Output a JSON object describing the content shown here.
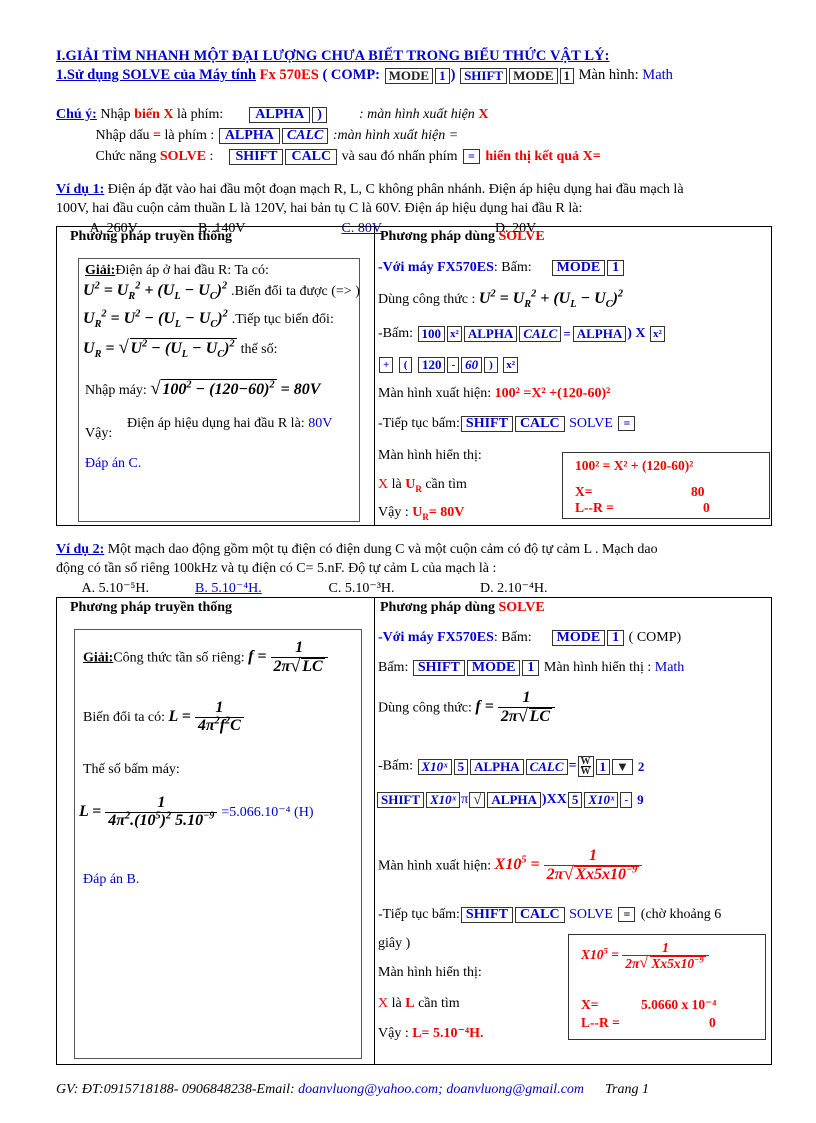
{
  "header": {
    "title": "I.GIẢI TÌM NHANH MỘT ĐẠI LƯỢNG CHƯA BIẾT TRONG BIỂU THỨC VẬT LÝ:",
    "line2_a": "1.Sử dụng  SOLVE  của Máy tính",
    "line2_calc": "Fx 570ES",
    "line2_b": "( COMP:",
    "key_mode": "MODE",
    "key_1": "1",
    "line2_c": ")",
    "key_shift": "SHIFT",
    "key_mode2": "MODE",
    "key_1b": "1",
    "line2_d": "Màn hình:",
    "line2_math": "Math"
  },
  "note": {
    "label": "Chú ý:",
    "r1_a": "Nhập",
    "r1_var": "biến X",
    "r1_b": "là phím:",
    "r1_key1": "ALPHA",
    "r1_key2": ")",
    "r1_c": ": màn hình xuất hiện",
    "r1_x": "X",
    "r2_a": "Nhập dấu",
    "r2_eq": "=",
    "r2_b": "là  phím :",
    "r2_key1": "ALPHA",
    "r2_key2": "CALC",
    "r2_c": ":màn hình xuất hiện =",
    "r3_a": "Chức năng",
    "r3_solve": "SOLVE",
    "r3_colon": ":",
    "r3_key1": "SHIFT",
    "r3_key2": "CALC",
    "r3_b": "và sau đó nhấn  phím",
    "r3_key3": "=",
    "r3_c": "hiển thị kết  quả X="
  },
  "example1": {
    "label": "Ví dụ 1:",
    "prompt_l1": "Điện áp đặt vào hai đầu một đoạn mạch R, L, C không phân nhánh. Điện áp hiệu dụng hai đầu mạch là",
    "prompt_l2": "100V, hai đầu cuộn cảm thuần L là 120V, hai bản tụ C là 60V. Điện áp hiệu  dụng hai đầu R là:",
    "options": [
      "A. 260V",
      "B. 140V",
      "C. 80V",
      "D. 20V"
    ],
    "answer_key": "C",
    "left_caption": "Phương pháp truyền thống",
    "right_caption_a": "Phương pháp dùng",
    "right_caption_b": "SOLVE",
    "left": {
      "giai": "Giải:",
      "l1": "Điện áp ở hai đầu R: Ta có:",
      "eq1_tail": ".Biến  đổi ta được (=> )",
      "eq2_tail": ".Tiếp tục biến  đổi:",
      "eq3_tail": "thế số:",
      "l2": "Nhập máy:",
      "numeric_result": "80V",
      "vay": "Vậy:",
      "concl_a": "Điện áp hiệu  dụng hai đầu R là:",
      "concl_b": "80V",
      "dapan": "Đáp án C."
    },
    "right": {
      "r1_a": "-Với máy FX570ES",
      "r1_b": ": Bấm:",
      "r1_key1": "MODE",
      "r1_key2": "1",
      "r2": "Dùng  công thức :",
      "r3_label": "-Bấm:",
      "keys_row1": [
        "100",
        "x²",
        "ALPHA",
        "CALC",
        "=",
        "ALPHA",
        ")",
        "X",
        "x²"
      ],
      "keys_row2": [
        "+",
        "(",
        "120",
        "-",
        "60",
        ")",
        "x²"
      ],
      "r4_label": "Màn hình  xuất hiện:",
      "r4_expr": "100² =X² +(120-60)²",
      "r5_label": "-Tiếp tục bấm:",
      "r5_key1": "SHIFT",
      "r5_key2": "CALC",
      "r5_solve": "SOLVE",
      "r5_key3": "=",
      "r6_label": "Màn hình  hiển thị:",
      "r7": "X là UR cần tìm",
      "r7_x": "X",
      "r7_la": "là",
      "r7_ur": "U",
      "r7_ur_sub": "R",
      "r7_tail": "cần tìm",
      "r8_vay": "Vậy :",
      "r8_res": "U",
      "r8_res_sub": "R",
      "r8_res_tail": "= 80V",
      "display": {
        "line1": "100² = X² +  (120-60)²",
        "x_label": "X=",
        "x_value": "80",
        "lr_label": "L--R =",
        "lr_value": "0"
      }
    }
  },
  "example2": {
    "label": "Ví dụ 2:",
    "prompt_l1": "Một mạch dao động gồm một tụ điện có điện dung C và một cuộn cảm có độ tự cảm L . Mạch dao",
    "prompt_l2": "động có tần số riêng  100kHz và tụ điện có C= 5.nF. Độ tự cảm L của mạch là :",
    "options": [
      "A. 5.10⁻⁵H.",
      "B. 5.10⁻⁴H.",
      "C. 5.10⁻³H.",
      "D. 2.10⁻⁴H."
    ],
    "answer_key": "B",
    "left_caption": "Phương pháp  truyền thống",
    "right_caption_a": "Phương pháp dùng",
    "right_caption_b": "SOLVE",
    "left": {
      "giai": "Giải:",
      "l1": "Công thức tần số riêng:",
      "l2": "Biến  đổi ta có:",
      "l3": "Thế số bấm máy:",
      "result": "=5.066.10⁻⁴ (H)",
      "dapan": "Đáp án B."
    },
    "right": {
      "r1_a": "-Với máy FX570ES",
      "r1_b": ": Bấm:",
      "r1_key1": "MODE",
      "r1_key2": "1",
      "r1_c": "( COMP)",
      "r2_label": "Bấm:",
      "r2_key1": "SHIFT",
      "r2_key2": "MODE",
      "r2_key3": "1",
      "r2_tail": "Màn hình  hiển  thị :",
      "r2_math": "Math",
      "r3": "Dùng  công thức:",
      "r4_label": "-Bấm:",
      "keys_row1": [
        "X10ˣ",
        "5",
        "ALPHA",
        "CALC",
        "=",
        "W/W",
        "1",
        "▼",
        "2"
      ],
      "keys_row2": [
        "SHIFT",
        "X10ˣ",
        "π",
        "√",
        "ALPHA",
        ")",
        "X",
        "X",
        "5",
        "X10ˣ",
        "-",
        "9"
      ],
      "r5_label": "Màn hình  xuất hiện:",
      "r6_label": "-Tiếp tục bấm:",
      "r6_key1": "SHIFT",
      "r6_key2": "CALC",
      "r6_solve": "SOLVE",
      "r6_key3": "=",
      "r6_tail": "(chờ khoảng 6",
      "r6_tail2": "giây )",
      "r7_label": "Màn hình  hiển  thị:",
      "r8_x": "X",
      "r8_la": "là",
      "r8_l": "L",
      "r8_tail": "cần tìm",
      "r9_vay": "Vậy :",
      "r9_res": "L= 5.10⁻⁴H.",
      "display": {
        "x_label": "X=",
        "x_value": "5.0660 x 10⁻⁴",
        "lr_label": "L--R =",
        "lr_value": "0"
      }
    }
  },
  "footer": {
    "a": "GV: ĐT:0915718188- 0906848238-Email:",
    "email1": "doanvluong@yahoo.com;",
    "email2": "doanvluong@gmail.com",
    "page": "Trang 1"
  },
  "colors": {
    "blue": "#0000cc",
    "red": "#ee0000",
    "black": "#000000"
  }
}
